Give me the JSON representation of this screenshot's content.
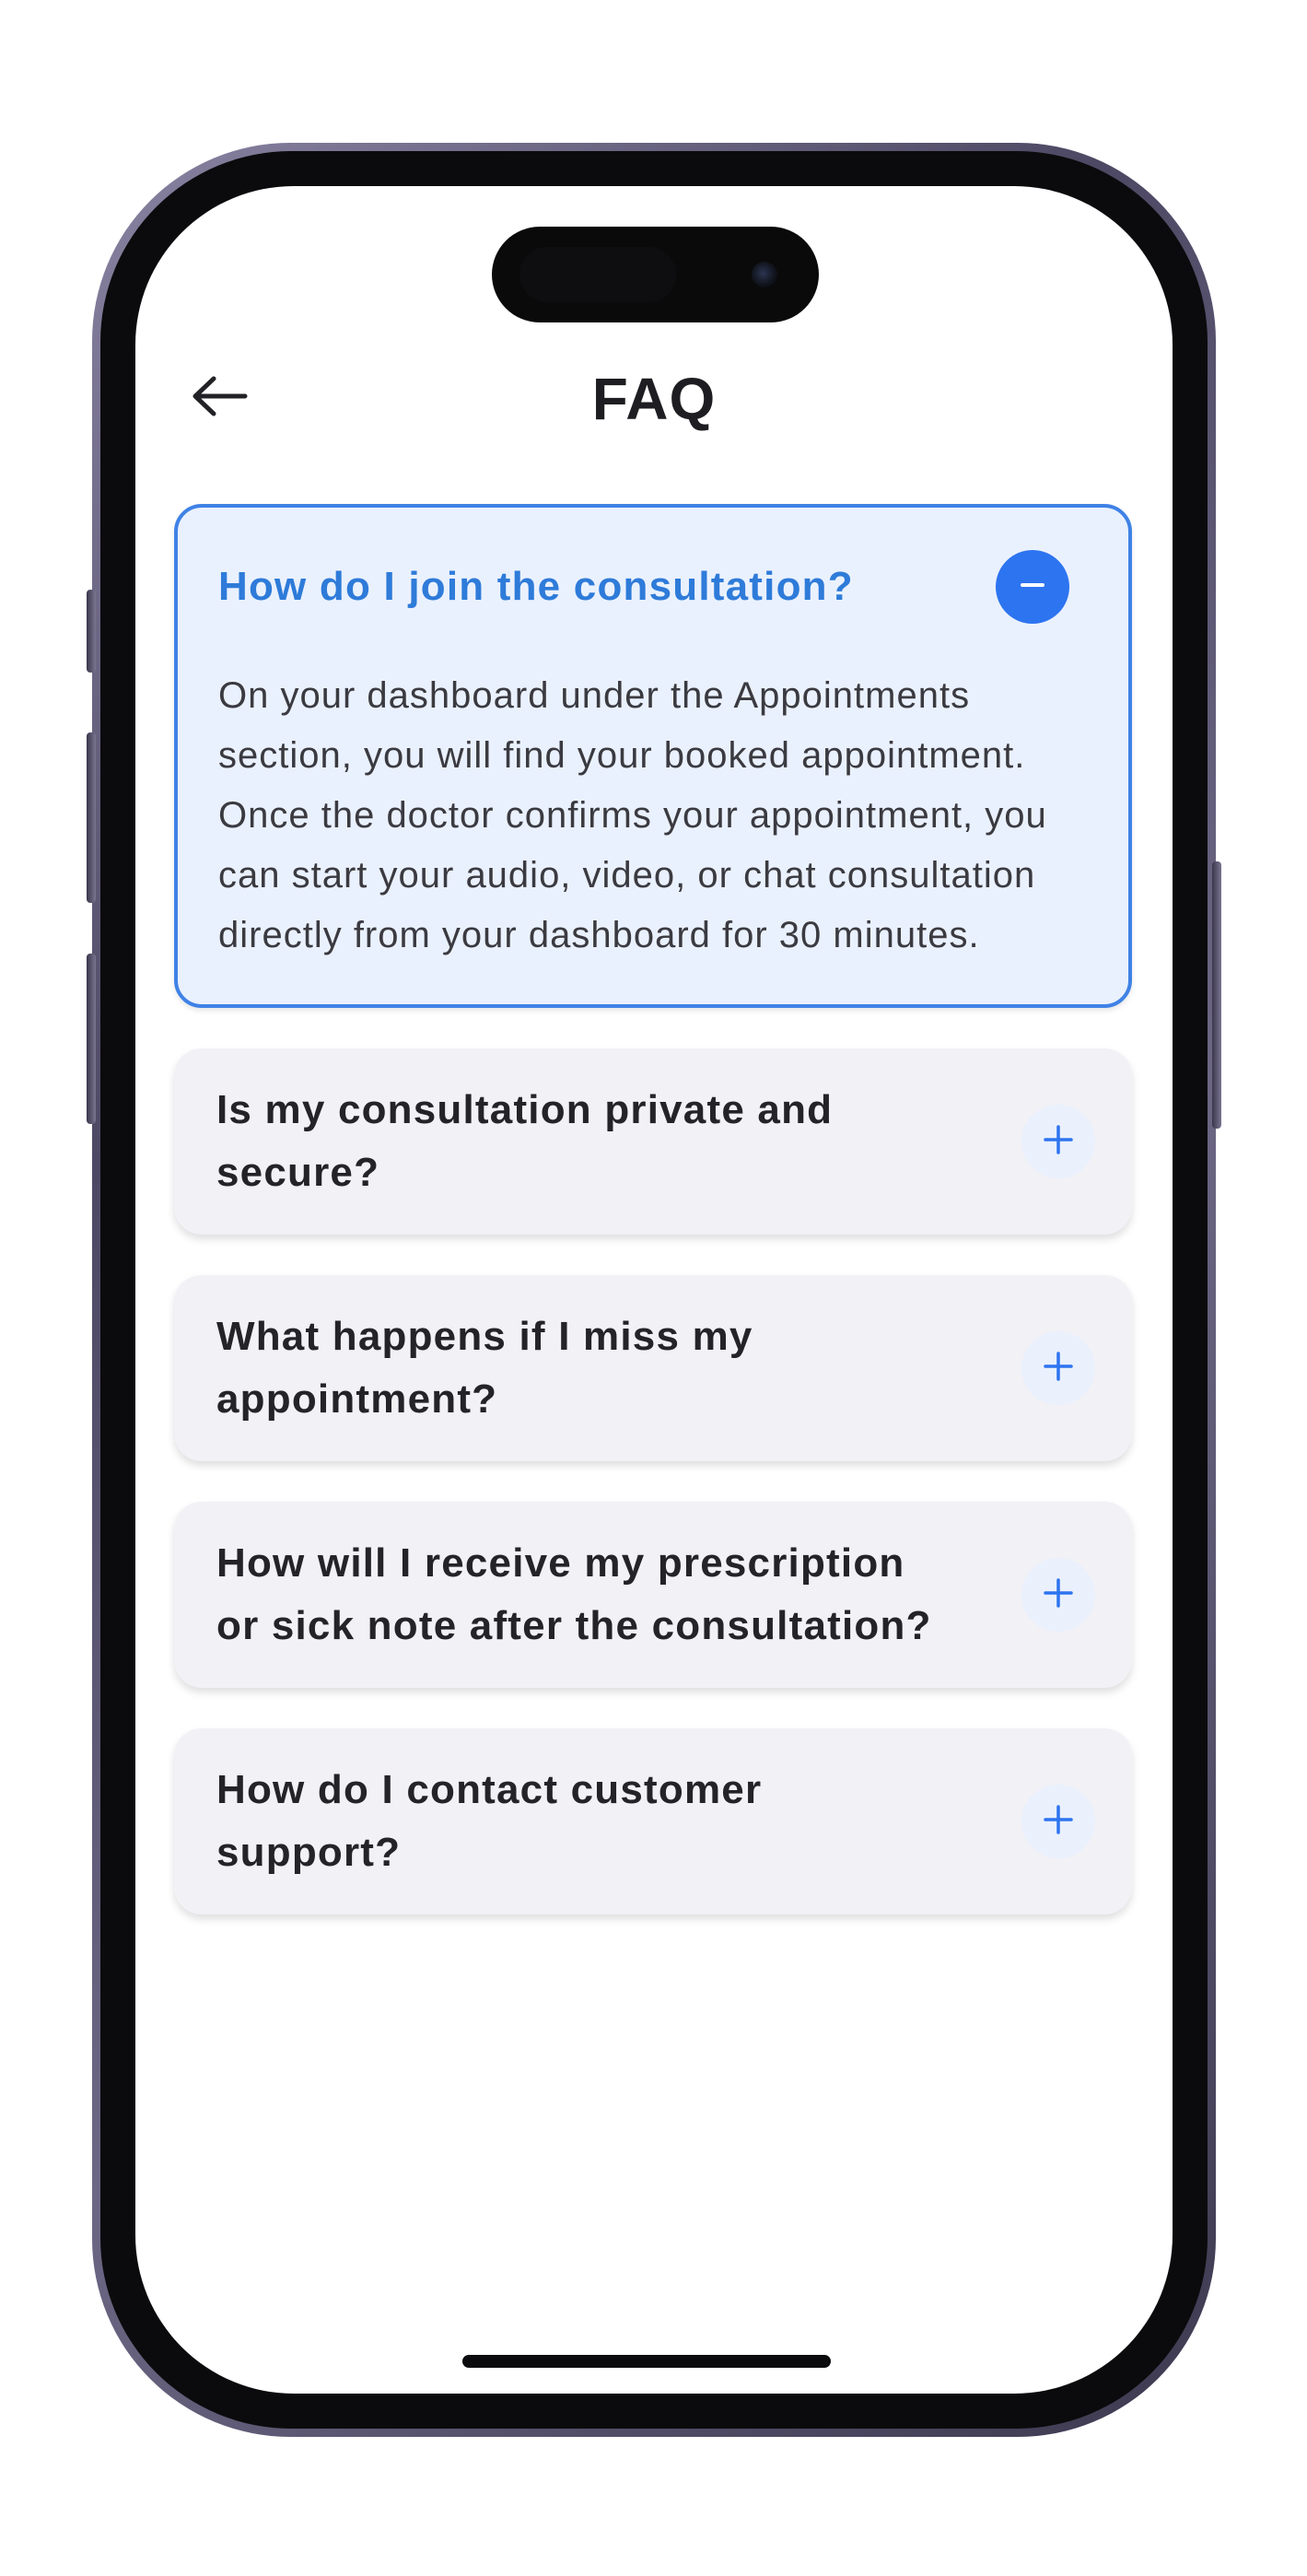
{
  "header": {
    "title": "FAQ",
    "back_icon": "arrow-left-icon"
  },
  "faq": [
    {
      "question": "How do I join the consultation?",
      "answer": "On your dashboard under the Appointments section, you will find your booked appointment. Once the doctor confirms your appointment, you can start your audio, video, or chat consultation directly from your dashboard for 30 minutes.",
      "expanded": true,
      "toggle_icon": "minus-icon"
    },
    {
      "question": "Is my consultation private and secure?",
      "expanded": false,
      "toggle_icon": "plus-icon"
    },
    {
      "question": "What happens if I miss my appointment?",
      "expanded": false,
      "toggle_icon": "plus-icon"
    },
    {
      "question": "How will I receive my prescription or sick note after the consultation?",
      "expanded": false,
      "toggle_icon": "plus-icon"
    },
    {
      "question": "How do I contact customer support?",
      "expanded": false,
      "toggle_icon": "plus-icon"
    }
  ],
  "colors": {
    "accent": "#2d74f0",
    "accent_text": "#2e7bd9",
    "open_card_bg": "#eaf1fe",
    "card_bg": "#f1f1f6",
    "text": "#242428"
  }
}
